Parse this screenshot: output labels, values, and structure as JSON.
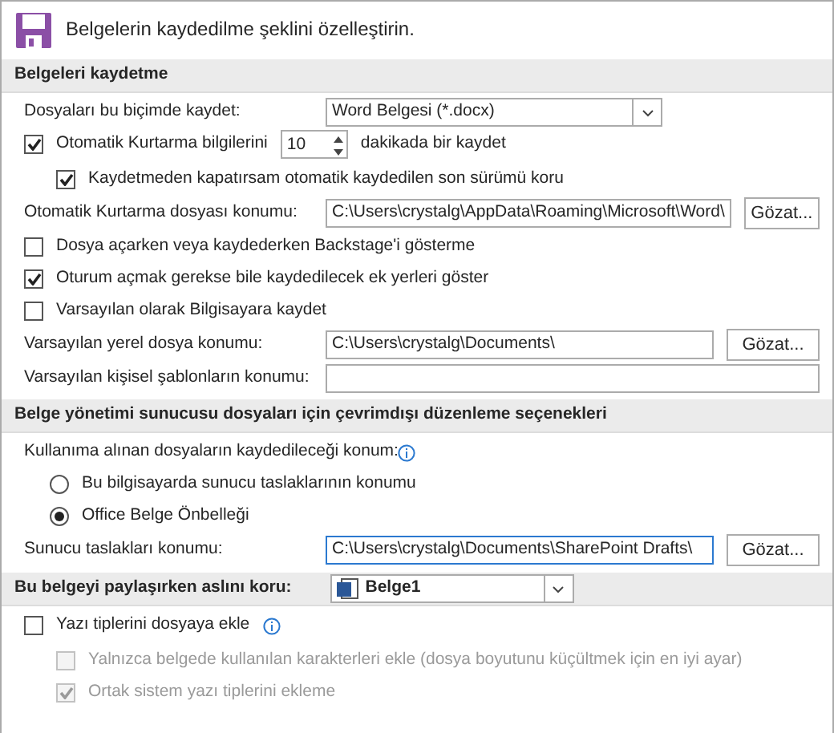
{
  "header": {
    "title": "Belgelerin kaydedilme şeklini özelleştirin."
  },
  "sections": [
    {
      "heading": "Belgeleri kaydetme",
      "items": [
        {
          "kind": "select",
          "label": "Dosyaları bu biçimde kaydet:",
          "value": "Word Belgesi (*.docx)"
        },
        {
          "kind": "spin",
          "label": "Otomatik Kurtarma bilgilerini",
          "checked": true,
          "value": "10",
          "suffix": "dakikada bir kaydet",
          "children": [
            {
              "kind": "checkbox",
              "label": "Kaydetmeden kapatırsam otomatik kaydedilen son sürümü koru",
              "checked": true,
              "disabled": false
            }
          ]
        },
        {
          "kind": "path",
          "label": "Otomatik Kurtarma dosyası konumu:",
          "value": "C:\\Users\\crystalg\\AppData\\Roaming\\Microsoft\\Word\\",
          "button": "Gözat..."
        },
        {
          "kind": "checkbox",
          "label": "Dosya açarken veya kaydederken Backstage'i gösterme",
          "checked": false,
          "disabled": false
        },
        {
          "kind": "checkbox",
          "label": "Oturum açmak gerekse bile kaydedilecek ek yerleri göster",
          "checked": true,
          "disabled": false
        },
        {
          "kind": "checkbox",
          "label": "Varsayılan olarak Bilgisayara kaydet",
          "checked": false,
          "disabled": false
        },
        {
          "kind": "path",
          "label": "Varsayılan yerel dosya konumu:",
          "value": "C:\\Users\\crystalg\\Documents\\",
          "button": "Gözat..."
        },
        {
          "kind": "path",
          "label": "Varsayılan kişisel şablonların konumu:"
        }
      ]
    },
    {
      "heading": "Belge yönetimi sunucusu dosyaları için çevrimdışı düzenleme seçenekleri",
      "items": [
        {
          "kind": "note",
          "label": "Kullanıma alınan dosyaların kaydedileceği konum:",
          "info": true
        },
        {
          "kind": "radio",
          "label": "Bu bilgisayarda sunucu taslaklarının konumu",
          "selected": false
        },
        {
          "kind": "radio",
          "label": "Office Belge Önbelleği",
          "selected": true
        },
        {
          "kind": "path",
          "label": "Sunucu taslakları konumu:",
          "value": "C:\\Users\\crystalg\\Documents\\SharePoint Drafts\\",
          "button": "Gözat...",
          "focused": true
        }
      ]
    },
    {
      "heading": "Bu belgeyi paylaşırken aslını koru:",
      "document": "Belge1",
      "items": [
        {
          "kind": "checkbox",
          "label": "Yazı tiplerini dosyaya ekle",
          "checked": false,
          "disabled": false,
          "info": true,
          "children": [
            {
              "kind": "checkbox",
              "label": "Yalnızca belgede kullanılan karakterleri ekle (dosya boyutunu küçültmek için en iyi ayar)",
              "checked": false,
              "disabled": true
            },
            {
              "kind": "checkbox",
              "label": "Ortak sistem yazı tiplerini ekleme",
              "checked": true,
              "disabled": true
            }
          ]
        }
      ]
    }
  ]
}
